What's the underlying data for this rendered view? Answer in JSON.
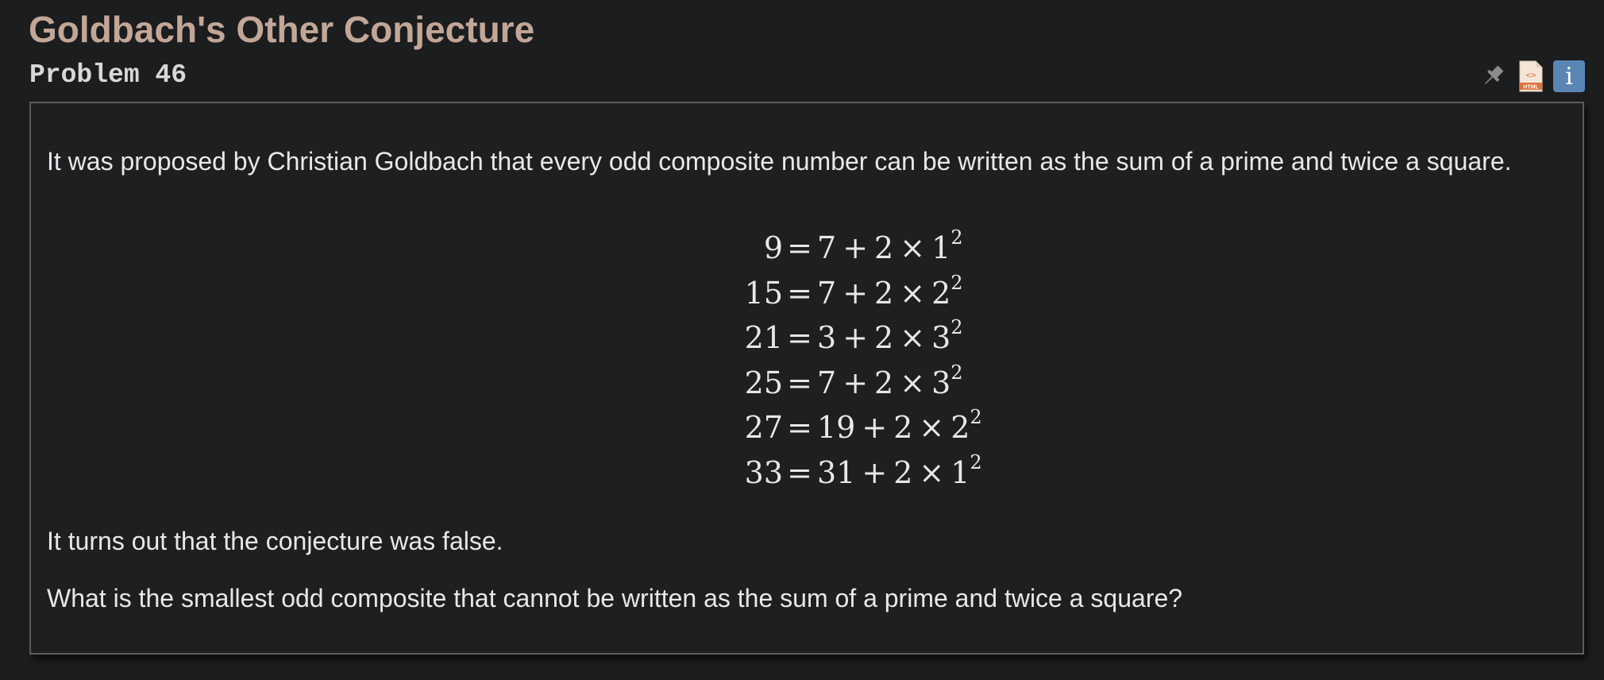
{
  "header": {
    "title": "Goldbach's Other Conjecture",
    "subtitle": "Problem 46",
    "icons": [
      "pin-icon",
      "html-file-icon",
      "info-icon"
    ],
    "info_label": "i",
    "html_label": "HTML"
  },
  "content": {
    "intro": "It was proposed by Christian Goldbach that every odd composite number can be written as the sum of a prime and twice a square.",
    "equations": [
      {
        "n": "9",
        "p": "7",
        "k": "1"
      },
      {
        "n": "15",
        "p": "7",
        "k": "2"
      },
      {
        "n": "21",
        "p": "3",
        "k": "3"
      },
      {
        "n": "25",
        "p": "7",
        "k": "3"
      },
      {
        "n": "27",
        "p": "19",
        "k": "2"
      },
      {
        "n": "33",
        "p": "31",
        "k": "1"
      }
    ],
    "equals": "=",
    "plus": "+",
    "two": "2",
    "times": "×",
    "exponent": "2",
    "conclusion": "It turns out that the conjecture was false.",
    "question": "What is the smallest odd composite that cannot be written as the sum of a prime and twice a square?"
  },
  "colors": {
    "background": "#1c1d1f",
    "title": "#c2a797",
    "text": "#e8e8e8",
    "info_button": "#5a86b3",
    "html_icon": "#e0703a"
  }
}
